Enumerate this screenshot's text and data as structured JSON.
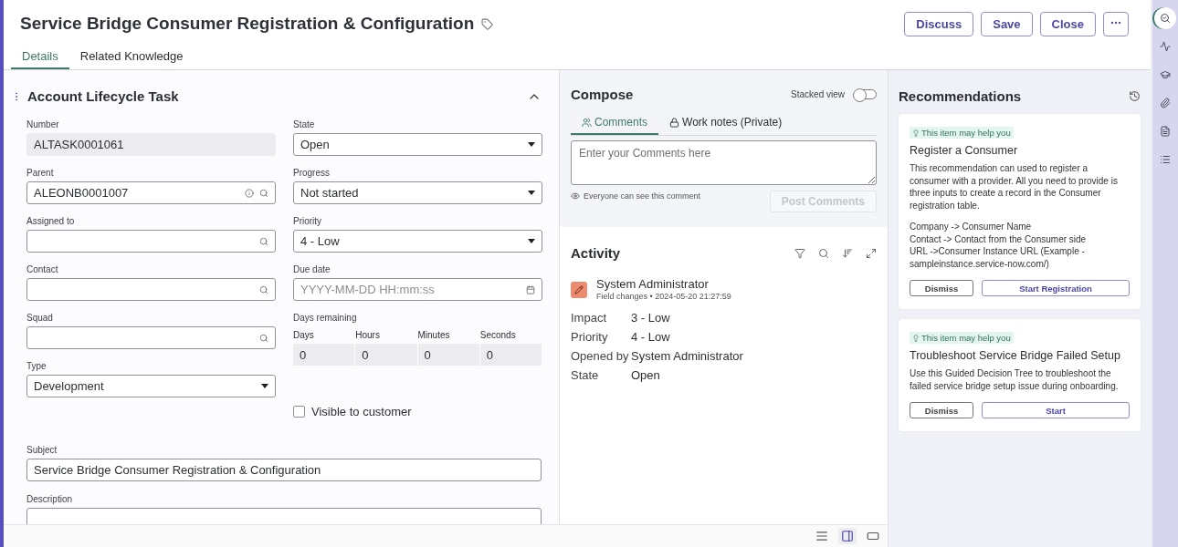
{
  "header": {
    "title": "Service Bridge Consumer Registration & Configuration",
    "buttons": [
      "Discuss",
      "Save",
      "Close"
    ]
  },
  "tabs": [
    {
      "label": "Details",
      "selected": true
    },
    {
      "label": "Related Knowledge",
      "selected": false
    }
  ],
  "form": {
    "title": "Account Lifecycle Task",
    "expanded": true,
    "left": [
      {
        "kind": "readonly",
        "label": "Number",
        "value": "ALTASK0001061"
      },
      {
        "kind": "lookup-info",
        "label": "Parent",
        "value": "ALEONB0001007"
      },
      {
        "kind": "lookup",
        "label": "Assigned to"
      },
      {
        "kind": "lookup",
        "label": "Contact"
      },
      {
        "kind": "lookup",
        "label": "Squad"
      },
      {
        "kind": "select",
        "label": "Type",
        "value": "Development"
      }
    ],
    "right": [
      {
        "kind": "select",
        "label": "State",
        "value": "Open"
      },
      {
        "kind": "select",
        "label": "Progress",
        "value": "Not started"
      },
      {
        "kind": "select",
        "label": "Priority",
        "value": "4 - Low"
      },
      {
        "kind": "date",
        "label": "Due date",
        "placeholder": "YYYY-MM-DD HH:mm:ss"
      },
      {
        "kind": "countdown",
        "label": "Days remaining",
        "units": [
          {
            "label": "Days",
            "value": "0"
          },
          {
            "label": "Hours",
            "value": "0"
          },
          {
            "label": "Minutes",
            "value": "0"
          },
          {
            "label": "Seconds",
            "value": "0"
          }
        ]
      },
      {
        "kind": "checkbox",
        "label": "Visible to customer",
        "checked": false
      }
    ],
    "full": [
      {
        "kind": "text",
        "label": "Subject",
        "value": "Service Bridge Consumer Registration & Configuration"
      },
      {
        "kind": "textarea",
        "label": "Description"
      }
    ]
  },
  "compose": {
    "title": "Compose",
    "stacked_view": {
      "label": "Stacked view",
      "on": false
    },
    "tabs": [
      {
        "kind": "comments",
        "label": "Comments",
        "selected": true
      },
      {
        "kind": "work-notes",
        "label": "Work notes (Private)",
        "selected": false
      }
    ],
    "placeholder": "Enter your Comments here",
    "visibility_note": "Everyone can see this comment",
    "post_button": {
      "label": "Post Comments",
      "disabled": true
    }
  },
  "activity": {
    "title": "Activity",
    "entries": [
      {
        "author": "System Administrator",
        "meta": "Field changes • 2024-05-20 21:27:59",
        "changes": [
          {
            "field": "Impact",
            "value": "3 - Low"
          },
          {
            "field": "Priority",
            "value": "4 - Low"
          },
          {
            "field": "Opened by",
            "value": "System Administrator"
          },
          {
            "field": "State",
            "value": "Open"
          }
        ]
      }
    ]
  },
  "recommendations": {
    "title": "Recommendations",
    "cards": [
      {
        "tag": "This item may help you",
        "title": "Register a Consumer",
        "description": "This recommendation can used to register a consumer with a provider. All you need to provide is three inputs to create a record in the Consumer registration table.",
        "mappings": [
          "Company -> Consumer Name",
          "Contact -> Contact from the Consumer side",
          "URL ->Consumer Instance URL (Example - sampleinstance.service-now.com/)"
        ],
        "buttons": [
          {
            "kind": "secondary",
            "label": "Dismiss"
          },
          {
            "kind": "primary",
            "label": "Start Registration"
          }
        ]
      },
      {
        "tag": "This item may help you",
        "title": "Troubleshoot Service Bridge Failed Setup",
        "description": "Use this Guided Decision Tree to troubleshoot the failed service bridge setup issue during onboarding.",
        "buttons": [
          {
            "kind": "secondary",
            "label": "Dismiss"
          },
          {
            "kind": "primary",
            "label": "Start"
          }
        ]
      }
    ]
  },
  "rail": [
    {
      "kind": "recommendations",
      "selected": true
    },
    {
      "kind": "activity",
      "selected": false
    },
    {
      "kind": "learning",
      "selected": false
    },
    {
      "kind": "attachments",
      "selected": false
    },
    {
      "kind": "document",
      "selected": false
    },
    {
      "kind": "outline",
      "selected": false
    }
  ],
  "views": [
    {
      "kind": "list",
      "selected": false
    },
    {
      "kind": "split",
      "selected": true
    },
    {
      "kind": "single",
      "selected": false
    }
  ]
}
